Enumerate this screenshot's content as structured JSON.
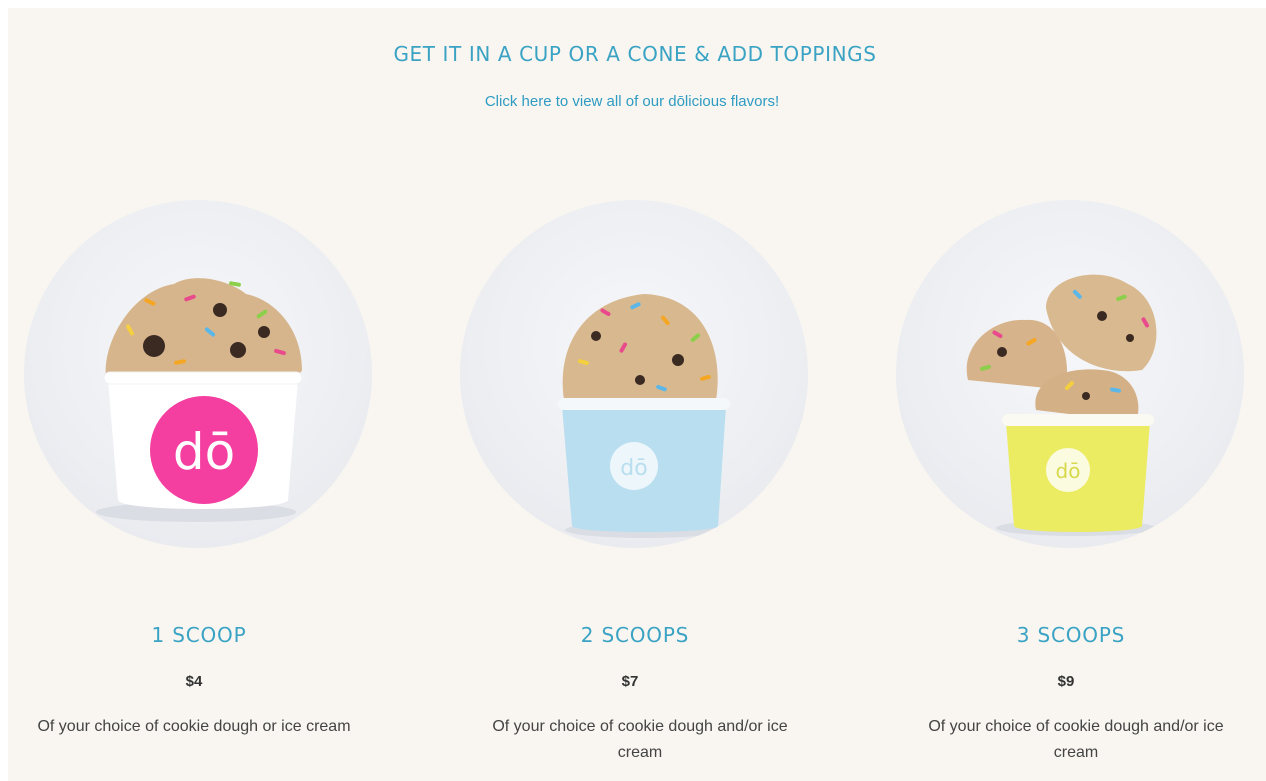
{
  "section": {
    "headline": "GET IT IN A CUP OR A CONE  & ADD TOPPINGS",
    "flavors_link": "Click here to view all of our dōlicious flavors!"
  },
  "cards": [
    {
      "title": "1 SCOOP",
      "price": "$4",
      "description": "Of your choice of cookie dough or ice cream",
      "cup_logo": "dō",
      "cup_color": "#ffffff",
      "logo_color": "#f43fa0"
    },
    {
      "title": "2 SCOOPS",
      "price": "$7",
      "description": "Of your choice of cookie dough and/or ice cream",
      "cup_logo": "dō",
      "cup_color": "#b9def0",
      "logo_color": "#ffffff"
    },
    {
      "title": "3 SCOOPS",
      "price": "$9",
      "description": "Of your choice of cookie dough and/or ice cream",
      "cup_logo": "dō",
      "cup_color": "#ecec63",
      "logo_color": "#ffffff"
    }
  ],
  "colors": {
    "accent": "#3aa3c4",
    "background": "#f9f6f1",
    "text": "#444444"
  }
}
